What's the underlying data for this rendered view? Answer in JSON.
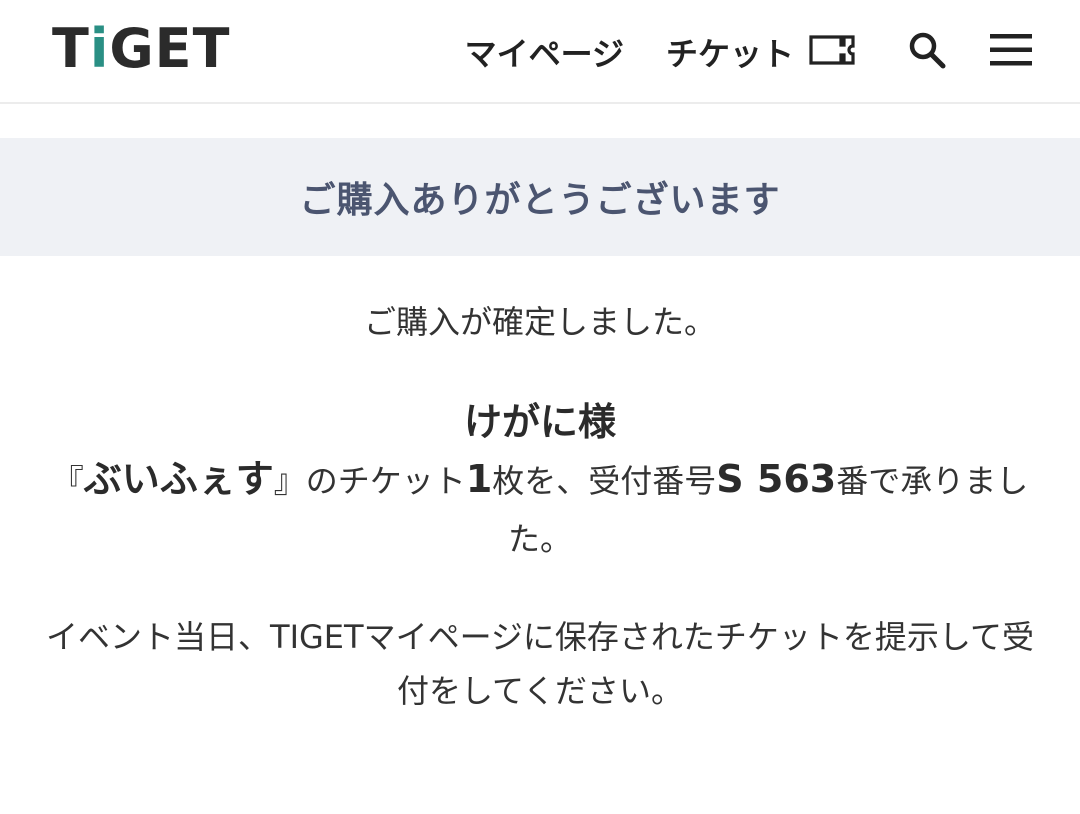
{
  "header": {
    "logo": {
      "text_before": "T",
      "text_i": "i",
      "text_after": "GET"
    },
    "nav": {
      "mypage_label": "マイページ",
      "ticket_label": "チケット",
      "ticket_icon": "ticket-icon",
      "search_icon": "search-icon",
      "menu_icon": "hamburger-menu-icon"
    }
  },
  "banner": {
    "title": "ご購入ありがとうございます"
  },
  "content": {
    "confirm_text": "ご購入が確定しました。",
    "customer_name": "けがに様",
    "message": {
      "part1": "『",
      "event_name": "ぶいふぇす",
      "part2": "』のチケット",
      "count": "1",
      "part3": "枚を、受付番号",
      "receipt_number": "S 563",
      "part4": "番で承りました。"
    },
    "notice": "イベント当日、TIGETマイページに保存されたチケットを提示して受付をしてください。"
  },
  "colors": {
    "accent": "#2a8f84",
    "banner_bg": "#eff1f5",
    "banner_text": "#4b5570"
  }
}
